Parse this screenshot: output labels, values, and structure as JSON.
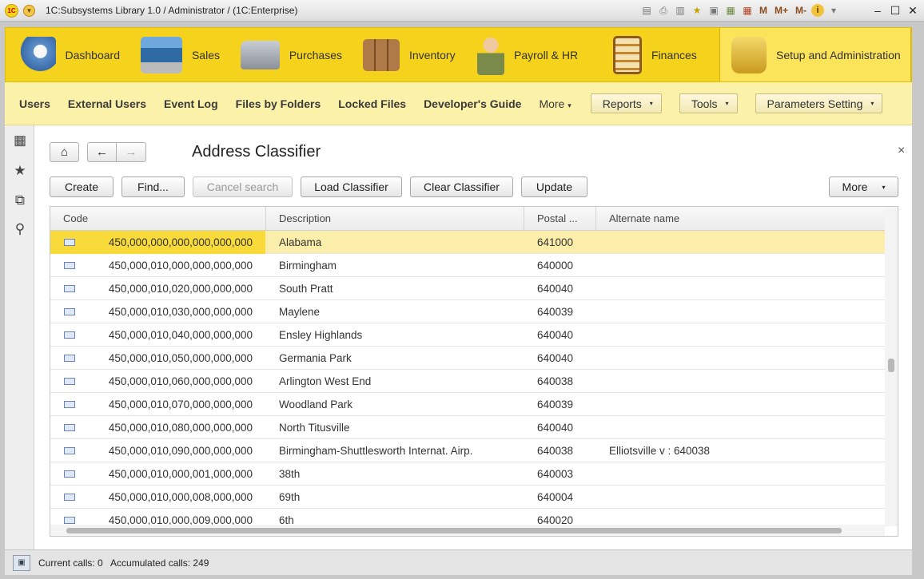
{
  "window": {
    "title": "1C:Subsystems Library 1.0 / Administrator /  (1C:Enterprise)",
    "logo": "1C",
    "toolbar_icons": [
      "save-icon",
      "print-icon",
      "preview-icon",
      "favorites-icon",
      "history-icon",
      "calculator-icon",
      "calendar-icon"
    ],
    "memory_labels": [
      "M",
      "M+",
      "M-"
    ],
    "info_icon": "i",
    "dropdown_glyph": "▾",
    "minimize": "–",
    "maximize": "☐",
    "close": "✕"
  },
  "sections": [
    {
      "label": "Dashboard",
      "icon": "desk-lamp-icon",
      "color": "#5b8fc9"
    },
    {
      "label": "Sales",
      "icon": "cash-register-icon",
      "color": "#3a7fb8"
    },
    {
      "label": "Purchases",
      "icon": "truck-icon",
      "color": "#8a8f98"
    },
    {
      "label": "Inventory",
      "icon": "boxes-icon",
      "color": "#a0683a"
    },
    {
      "label": "Payroll & HR",
      "icon": "person-icon",
      "color": "#7a8a4a"
    },
    {
      "label": "Finances",
      "icon": "abacus-icon",
      "color": "#a06a2a"
    },
    {
      "label": "Setup and Administration",
      "icon": "database-computer-icon",
      "color": "#d6a81e"
    }
  ],
  "commands": {
    "links": [
      "Users",
      "External Users",
      "Event Log",
      "Files by Folders",
      "Locked Files",
      "Developer's Guide"
    ],
    "more": "More",
    "arrow": "▾",
    "dropdowns": [
      "Reports",
      "Tools",
      "Parameters Setting"
    ]
  },
  "left_panel": {
    "icons": [
      {
        "name": "apps-grid-icon",
        "glyph": "▦"
      },
      {
        "name": "favorites-star-icon",
        "glyph": "★"
      },
      {
        "name": "history-icon",
        "glyph": "⧉"
      },
      {
        "name": "search-icon",
        "glyph": "⚲"
      }
    ]
  },
  "form": {
    "title": "Address Classifier",
    "home": "⌂",
    "back": "←",
    "forward": "→",
    "close": "×",
    "buttons": {
      "create": "Create",
      "find": "Find...",
      "cancel_search": "Cancel search",
      "load": "Load Classifier",
      "clear": "Clear Classifier",
      "update": "Update",
      "more": "More",
      "more_arrow": "▾"
    }
  },
  "table": {
    "columns": [
      "Code",
      "Description",
      "Postal ...",
      "Alternate name"
    ],
    "rows": [
      {
        "code": "450,000,000,000,000,000,000",
        "description": "Alabama",
        "postal": "641000",
        "alternate": "",
        "selected": true
      },
      {
        "code": "450,000,010,000,000,000,000",
        "description": "Birmingham",
        "postal": "640000",
        "alternate": ""
      },
      {
        "code": "450,000,010,020,000,000,000",
        "description": "South Pratt",
        "postal": "640040",
        "alternate": ""
      },
      {
        "code": "450,000,010,030,000,000,000",
        "description": "Maylene",
        "postal": "640039",
        "alternate": ""
      },
      {
        "code": "450,000,010,040,000,000,000",
        "description": "Ensley Highlands",
        "postal": "640040",
        "alternate": ""
      },
      {
        "code": "450,000,010,050,000,000,000",
        "description": "Germania Park",
        "postal": "640040",
        "alternate": ""
      },
      {
        "code": "450,000,010,060,000,000,000",
        "description": "Arlington West End",
        "postal": "640038",
        "alternate": ""
      },
      {
        "code": "450,000,010,070,000,000,000",
        "description": "Woodland Park",
        "postal": "640039",
        "alternate": ""
      },
      {
        "code": "450,000,010,080,000,000,000",
        "description": "North Titusville",
        "postal": "640040",
        "alternate": ""
      },
      {
        "code": "450,000,010,090,000,000,000",
        "description": "Birmingham-Shuttlesworth Internat. Airp.",
        "postal": "640038",
        "alternate": "Elliotsville v : 640038"
      },
      {
        "code": "450,000,010,000,001,000,000",
        "description": "38th",
        "postal": "640003",
        "alternate": ""
      },
      {
        "code": "450,000,010,000,008,000,000",
        "description": "69th",
        "postal": "640004",
        "alternate": ""
      },
      {
        "code": "450,000,010,000,009,000,000",
        "description": "6th",
        "postal": "640020",
        "alternate": ""
      }
    ]
  },
  "status": {
    "text": "Current calls: 0   Accumulated calls: 249"
  },
  "colors": {
    "accent": "#f5d21c",
    "command_bar": "#fcf1a8",
    "selected_row": "#fbeeaa"
  }
}
